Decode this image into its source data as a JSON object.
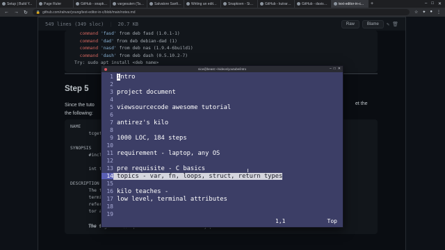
{
  "browser": {
    "tabs": [
      {
        "label": "Setup | Build Y...",
        "active": false
      },
      {
        "label": "Page Ruler",
        "active": false
      },
      {
        "label": "GitHub - snapko...",
        "active": false
      },
      {
        "label": "vargesuten (Targ...",
        "active": false
      },
      {
        "label": "Salvatore Sanfilip...",
        "active": false
      },
      {
        "label": "Writing an editor...",
        "active": false
      },
      {
        "label": "Snapkoen - Simi...",
        "active": false
      },
      {
        "label": "GitHub - kutrare(...",
        "active": false
      },
      {
        "label": "GitHub - davisbf...",
        "active": false
      },
      {
        "label": "text-editor-in-c...",
        "active": true
      }
    ],
    "url": "github.com/rahvar/young/text-editor-in-c/blob/main/notes.md"
  },
  "file_header": {
    "lines": "549 lines (349 sloc)",
    "size": "20.7 KB",
    "raw_label": "Raw",
    "blame_label": "Blame"
  },
  "codeblock1": {
    "lines": [
      {
        "cmd": "command",
        "name": "'fasd'",
        "rest": " from deb fasd (1.0.1-1)"
      },
      {
        "cmd": "command",
        "name": "'dad'",
        "rest": " from deb debian-dad (1)"
      },
      {
        "cmd": "command",
        "name": "'nasd'",
        "rest": " from deb nas (1.9.4-6build1)"
      },
      {
        "cmd": "command",
        "name": "'dash'",
        "rest": " from deb dash (0.5.10.2-7)"
      }
    ],
    "try_line": "Try: sudo apt install <deb name>"
  },
  "heading": "Step 5",
  "paragraph_left": [
    "Since the tuto",
    "the following:"
  ],
  "paragraph_right": "et the",
  "manpage": {
    "lines": [
      "NAME",
      "       tcget",
      "",
      "SYNOPSIS",
      "       #incl",
      "",
      "       int t",
      "",
      "DESCRIPTION",
      "       The t",
      "       termi",
      "       refer",
      "       tor a",
      "",
      "       The t"
    ],
    "trailing": "The tcgetattr() operation is allowed from any process."
  },
  "terminal": {
    "title": "nice@beast:~/videos/youtube/intro",
    "lines": [
      "intro",
      "",
      "project document",
      "",
      "viewsourcecode awesome tutorial",
      "",
      "antirez's kilo",
      "",
      "1000 LOC, 184 steps",
      "",
      "requirement - laptop, any OS",
      "",
      "pre requisite - C basics",
      "topics - var, fn, loops, struct, return types",
      "",
      "kilo teaches -",
      "low level, terminal attributes",
      "",
      ""
    ],
    "highlighted_line": 14,
    "cursor_pos": "1,1",
    "scroll": "Top"
  }
}
